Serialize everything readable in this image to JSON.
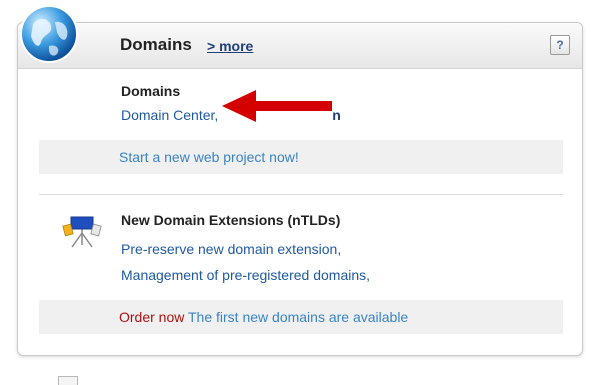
{
  "header": {
    "title": "Domains",
    "more_label": "> more",
    "help_label": "?"
  },
  "domains_section": {
    "title": "Domains",
    "link_domain_center": "Domain Center,",
    "link_obscured_suffix": "n",
    "cta": "Start a new web project now!"
  },
  "ntlds_section": {
    "title": "New Domain Extensions (nTLDs)",
    "line1": "Pre-reserve new domain extension,",
    "line2": "Management of pre-registered domains,",
    "order_now": "Order now",
    "order_text": "The first new domains are available"
  },
  "icons": {
    "globe": "globe-icon",
    "ntld": "flags-icon",
    "arrow": "red-arrow-annotation"
  },
  "colors": {
    "link_blue": "#3a84c6",
    "dark_blue": "#1f3f7a",
    "order_red": "#b01010",
    "arrow_red": "#d40000"
  }
}
